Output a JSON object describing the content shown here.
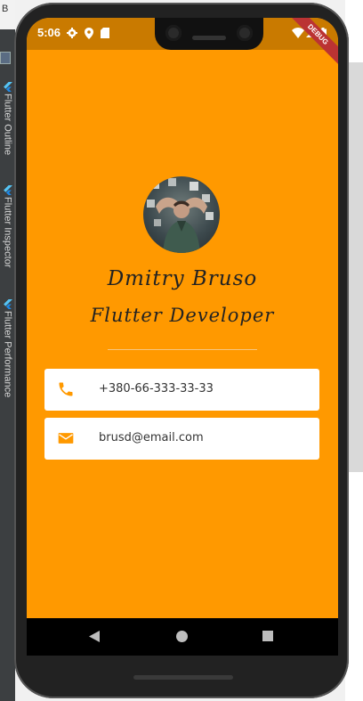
{
  "ide": {
    "top_letter": "B",
    "tabs": [
      "Flutter Outline",
      "Flutter Inspector",
      "Flutter Performance"
    ]
  },
  "status_bar": {
    "time": "5:06",
    "icons": [
      "settings-icon",
      "location-icon",
      "sim-icon",
      "wifi-icon",
      "signal-icon",
      "battery-icon"
    ]
  },
  "debug_banner": "DEBUG",
  "profile": {
    "name": "Dmitry Bruso",
    "title": "Flutter Developer",
    "phone": "+380-66-333-33-33",
    "email": "brusd@email.com"
  },
  "colors": {
    "background": "#ff9900",
    "status_bar": "#c97a00",
    "card": "#ffffff",
    "icon_accent": "#ff9900"
  },
  "nav": [
    "back-icon",
    "home-icon",
    "recents-icon"
  ]
}
